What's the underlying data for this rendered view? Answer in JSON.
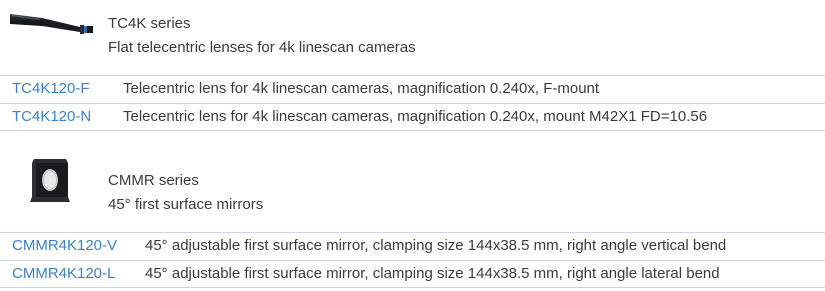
{
  "series": [
    {
      "icon": "telecentric-lens-image",
      "title": "TC4K series",
      "subtitle": "Flat telecentric lenses for 4k linescan cameras",
      "products": [
        {
          "code": "TC4K120-F",
          "description": "Telecentric lens for 4k linescan cameras, magnification 0.240x, F-mount"
        },
        {
          "code": "TC4K120-N",
          "description": "Telecentric lens for 4k linescan cameras, magnification 0.240x, mount M42X1 FD=10.56"
        }
      ]
    },
    {
      "icon": "mirror-block-image",
      "title": "CMMR series",
      "subtitle": "45° first surface mirrors",
      "products": [
        {
          "code": "CMMR4K120-V",
          "description": "45° adjustable first surface mirror, clamping size 144x38.5 mm, right angle vertical bend"
        },
        {
          "code": "CMMR4K120-L",
          "description": "45° adjustable first surface mirror, clamping size 144x38.5 mm, right angle lateral bend"
        }
      ]
    }
  ],
  "colors": {
    "link": "#3d82c2",
    "text": "#3b3b3b",
    "divider": "#c9d7e8"
  }
}
